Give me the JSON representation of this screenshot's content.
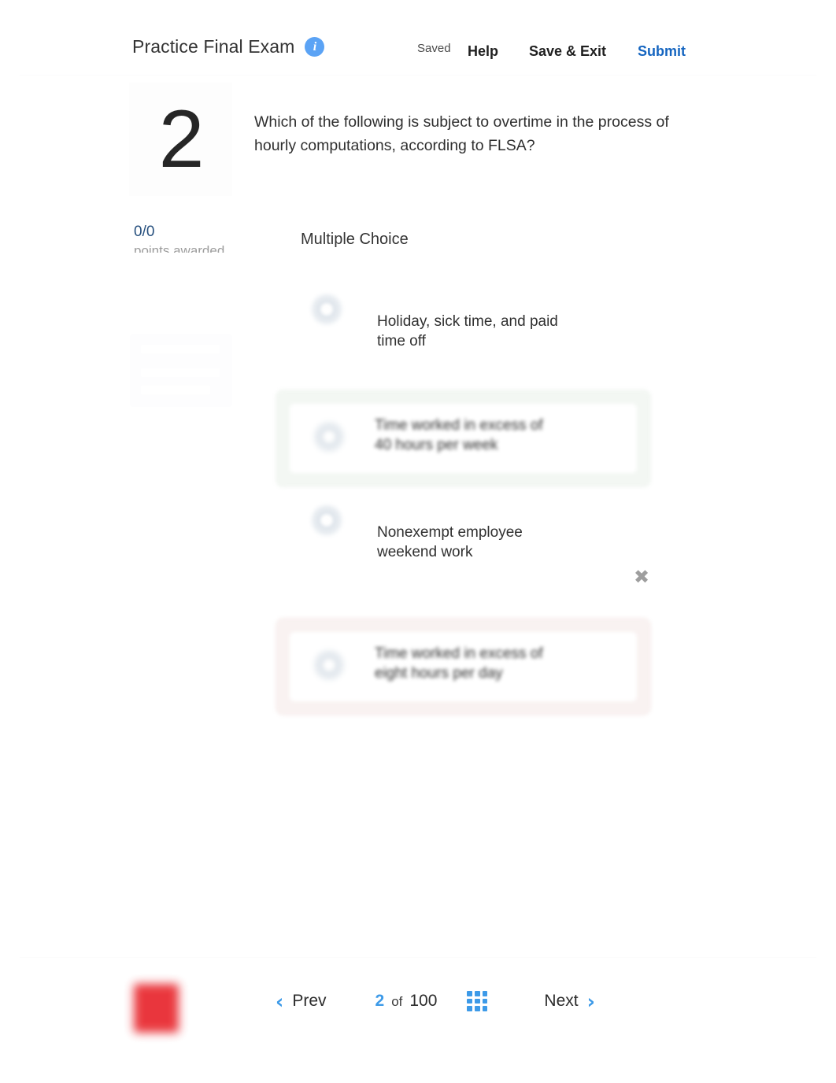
{
  "header": {
    "exam_title": "Practice Final Exam",
    "info_icon": "info-icon",
    "saved_status": "Saved",
    "help_label": "Help",
    "save_exit_label": "Save & Exit",
    "submit_label": "Submit",
    "accent_blue": "#1565c0",
    "info_icon_color": "#5ba3f5"
  },
  "question": {
    "number": "2",
    "prompt": "Which of the following is subject to overtime in the process of hourly computations, according to FLSA?",
    "points_value": "0/0",
    "points_label": "points awarded",
    "question_type": "Multiple Choice"
  },
  "choices": [
    {
      "text": "Holiday, sick time, and paid\ntime off",
      "state": "plain",
      "highlight": "none"
    },
    {
      "text": "Time worked in excess of\n40 hours per week",
      "state": "card",
      "highlight": "correct",
      "highlight_color": "#f3f7f3"
    },
    {
      "text": "Nonexempt employee\nweekend work",
      "state": "plain",
      "highlight": "none"
    },
    {
      "text": "Time worked in excess of\neight hours per day",
      "state": "card",
      "highlight": "incorrect",
      "highlight_color": "#f9f2f1",
      "marker": "✖"
    }
  ],
  "footer": {
    "prev_label": "Prev",
    "prev_chevron": "‹",
    "next_label": "Next",
    "next_chevron": "›",
    "current_page": "2",
    "of_label": "of",
    "total_pages": "100",
    "grid_icon": "grid-icon",
    "brand_color": "#e8262d"
  }
}
